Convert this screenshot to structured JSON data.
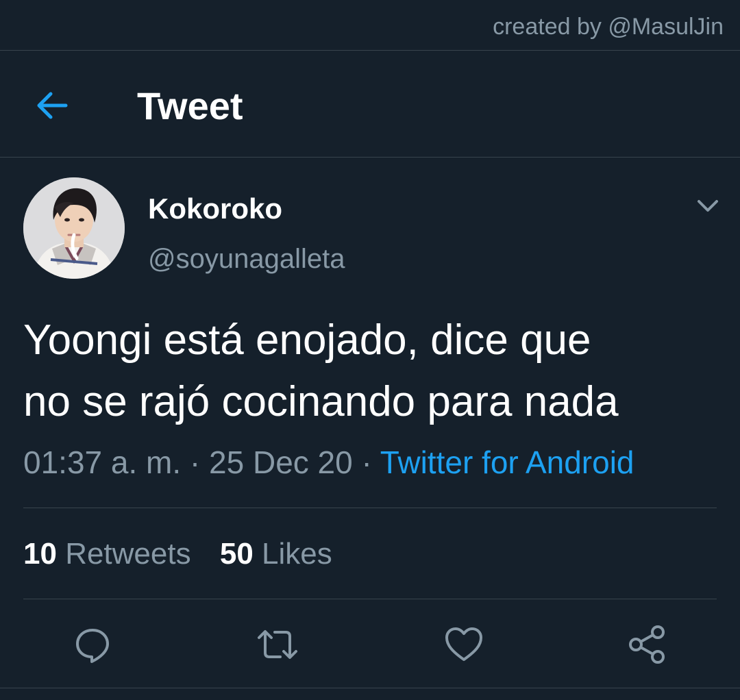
{
  "credit": "created by @MasulJin",
  "header": {
    "title": "Tweet",
    "back_icon": "arrow-left-icon"
  },
  "tweet": {
    "display_name": "Kokoroko",
    "handle": "@soyunagalleta",
    "text_lines": [
      "Yoongi está enojado, dice que",
      "no se rajó cocinando para nada"
    ],
    "time": "01:37 a. m.",
    "separator": "·",
    "date": "25 Dec 20",
    "source": "Twitter for Android",
    "retweets_count": "10",
    "retweets_label": "Retweets",
    "likes_count": "50",
    "likes_label": "Likes"
  },
  "actions": [
    {
      "icon": "reply-icon"
    },
    {
      "icon": "retweet-icon"
    },
    {
      "icon": "like-icon"
    },
    {
      "icon": "share-icon"
    }
  ],
  "colors": {
    "background": "#15202b",
    "border": "#38444d",
    "secondary_text": "#8899a6",
    "accent": "#1da1f2",
    "primary_text": "#ffffff"
  }
}
